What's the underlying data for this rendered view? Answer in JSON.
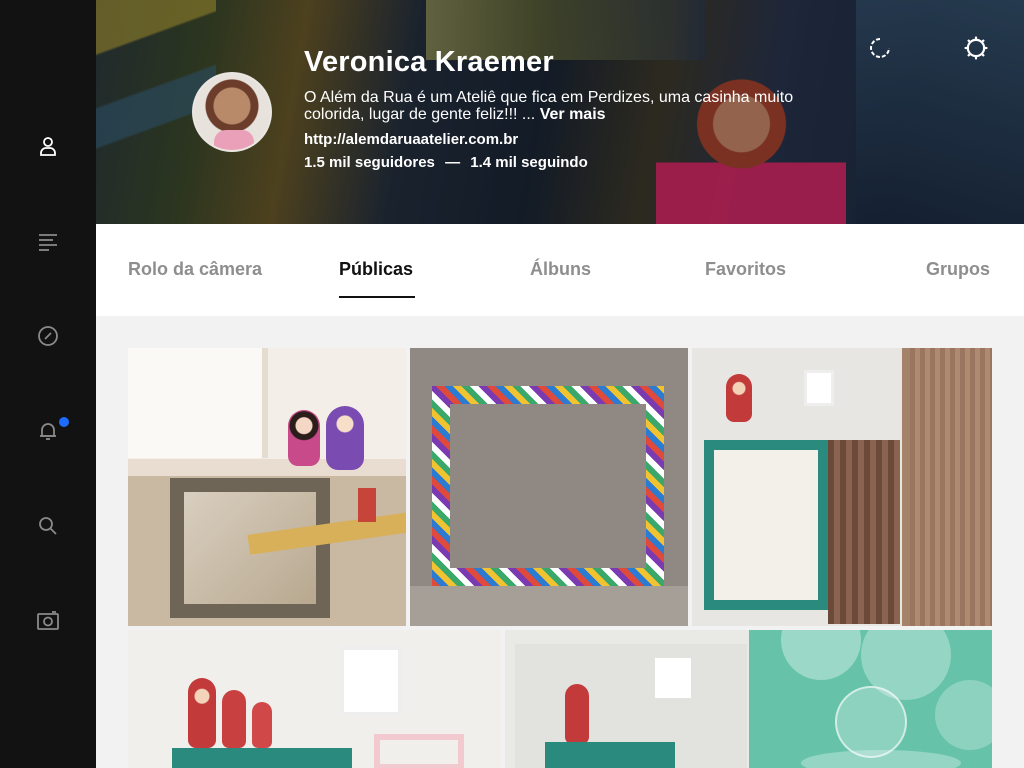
{
  "sidebar": {
    "items": [
      {
        "icon": "person-icon",
        "label": "Perfil"
      },
      {
        "icon": "menu-lines-icon",
        "label": "Feed"
      },
      {
        "icon": "compass-icon",
        "label": "Explorar"
      },
      {
        "icon": "bell-icon",
        "label": "Notificações"
      },
      {
        "icon": "search-icon",
        "label": "Buscar"
      },
      {
        "icon": "camera-icon",
        "label": "Câmera"
      }
    ],
    "notification_dot_color": "#1e6bff"
  },
  "profile": {
    "name": "Veronica Kraemer",
    "bio": "O Além da Rua é um Ateliê que fica em Perdizes, uma casinha muito colorida, lugar de gente feliz!!! ...",
    "see_more": "Ver mais",
    "website": "http://alemdaruaatelier.com.br",
    "followers": "1.5 mil seguidores",
    "separator": "—",
    "following": "1.4 mil seguindo"
  },
  "tabs": [
    {
      "label": "Rolo da câmera",
      "active": false
    },
    {
      "label": "Públicas",
      "active": true
    },
    {
      "label": "Álbuns",
      "active": false
    },
    {
      "label": "Favoritos",
      "active": false
    },
    {
      "label": "Grupos",
      "active": false
    }
  ],
  "colors": {
    "sidebar_bg": "#121212",
    "active_tab": "#111111",
    "inactive_tab": "#8e8e8e",
    "accent_blue": "#1e6bff"
  }
}
